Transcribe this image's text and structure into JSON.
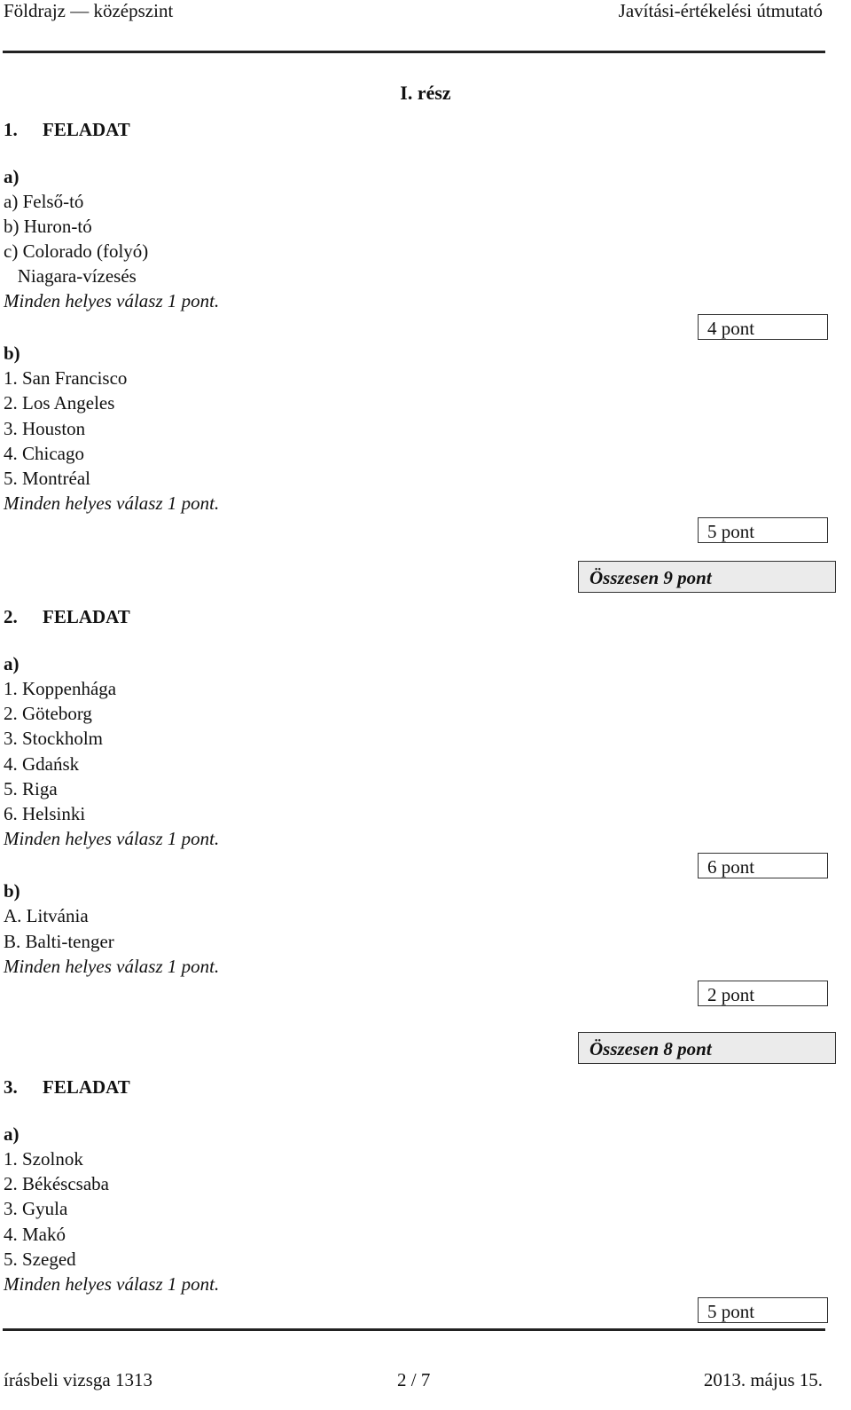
{
  "header": {
    "left": "Földrajz — középszint",
    "right": "Javítási-értékelési útmutató"
  },
  "part_title": "I. rész",
  "tasks": [
    {
      "number": "1.",
      "label": "FELADAT",
      "sections": [
        {
          "label": "a)",
          "items": [
            "a) Felső-tó",
            "b) Huron-tó",
            "c) Colorado (folyó)",
            "   Niagara-vízesés"
          ],
          "note": "Minden helyes válasz 1 pont.",
          "score": "4 pont"
        },
        {
          "label": "b)",
          "items": [
            "1. San Francisco",
            "2. Los Angeles",
            "3. Houston",
            "4. Chicago",
            "5. Montréal"
          ],
          "note": "Minden helyes válasz 1 pont.",
          "score": "5 pont"
        }
      ],
      "total": "Összesen 9 pont"
    },
    {
      "number": "2.",
      "label": "FELADAT",
      "sections": [
        {
          "label": "a)",
          "items": [
            "1. Koppenhága",
            "2. Göteborg",
            "3. Stockholm",
            "4. Gdańsk",
            "5. Riga",
            "6. Helsinki"
          ],
          "note": "Minden helyes válasz 1 pont.",
          "score": "6 pont"
        },
        {
          "label": "b)",
          "items": [
            "A. Litvánia",
            "B. Balti-tenger"
          ],
          "note": "Minden helyes válasz 1 pont.",
          "score": "2 pont"
        }
      ],
      "total": "Összesen 8 pont"
    },
    {
      "number": "3.",
      "label": "FELADAT",
      "sections": [
        {
          "label": "a)",
          "items": [
            "1. Szolnok",
            "2. Békéscsaba",
            "3. Gyula",
            "4. Makó",
            "5. Szeged"
          ],
          "note": "Minden helyes válasz 1 pont.",
          "score": "5 pont"
        }
      ]
    }
  ],
  "footer": {
    "left": "írásbeli vizsga 1313",
    "center": "2 / 7",
    "right": "2013. május 15."
  }
}
